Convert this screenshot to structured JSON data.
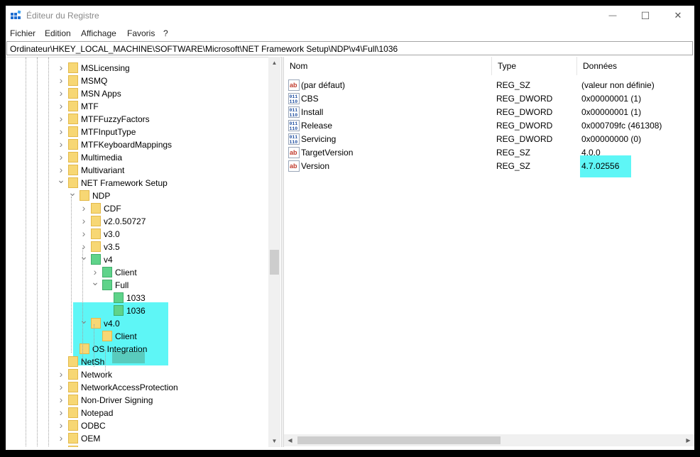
{
  "window": {
    "title": "Éditeur du Registre",
    "controls": {
      "minimize": "—",
      "maximize": "☐",
      "close": "✕"
    }
  },
  "menu": [
    "Fichier",
    "Edition",
    "Affichage",
    "Favoris",
    "?"
  ],
  "address": "Ordinateur\\HKEY_LOCAL_MACHINE\\SOFTWARE\\Microsoft\\NET Framework Setup\\NDP\\v4\\Full\\1036",
  "tree": {
    "items": [
      {
        "label": "MSLicensing",
        "expander": "collapsed"
      },
      {
        "label": "MSMQ",
        "expander": "collapsed"
      },
      {
        "label": "MSN Apps",
        "expander": "collapsed"
      },
      {
        "label": "MTF",
        "expander": "collapsed"
      },
      {
        "label": "MTFFuzzyFactors",
        "expander": "collapsed"
      },
      {
        "label": "MTFInputType",
        "expander": "collapsed"
      },
      {
        "label": "MTFKeyboardMappings",
        "expander": "collapsed"
      },
      {
        "label": "Multimedia",
        "expander": "collapsed"
      },
      {
        "label": "Multivariant",
        "expander": "collapsed"
      },
      {
        "label": "NET Framework Setup",
        "expander": "expanded"
      },
      {
        "label": "NDP",
        "expander": "expanded"
      },
      {
        "label": "CDF",
        "expander": "collapsed"
      },
      {
        "label": "v2.0.50727",
        "expander": "collapsed"
      },
      {
        "label": "v3.0",
        "expander": "collapsed"
      },
      {
        "label": "v3.5",
        "expander": "collapsed"
      },
      {
        "label": "v4",
        "expander": "expanded"
      },
      {
        "label": "Client",
        "expander": "collapsed"
      },
      {
        "label": "Full",
        "expander": "expanded"
      },
      {
        "label": "1033",
        "expander": "none"
      },
      {
        "label": "1036",
        "expander": "none",
        "selected": true
      },
      {
        "label": "v4.0",
        "expander": "expanded"
      },
      {
        "label": "Client",
        "expander": "none"
      },
      {
        "label": "OS Integration",
        "expander": "none"
      },
      {
        "label": "NetSh",
        "expander": "none"
      },
      {
        "label": "Network",
        "expander": "collapsed"
      },
      {
        "label": "NetworkAccessProtection",
        "expander": "collapsed"
      },
      {
        "label": "Non-Driver Signing",
        "expander": "collapsed"
      },
      {
        "label": "Notepad",
        "expander": "collapsed"
      },
      {
        "label": "ODBC",
        "expander": "collapsed"
      },
      {
        "label": "OEM",
        "expander": "collapsed"
      },
      {
        "label": "Office",
        "expander": "collapsed"
      }
    ]
  },
  "values": {
    "columns": [
      "Nom",
      "Type",
      "Données"
    ],
    "rows": [
      {
        "icon": "string-value-icon",
        "name": "(par défaut)",
        "type": "REG_SZ",
        "data": "(valeur non définie)"
      },
      {
        "icon": "dword-value-icon",
        "name": "CBS",
        "type": "REG_DWORD",
        "data": "0x00000001 (1)"
      },
      {
        "icon": "dword-value-icon",
        "name": "Install",
        "type": "REG_DWORD",
        "data": "0x00000001 (1)"
      },
      {
        "icon": "dword-value-icon",
        "name": "Release",
        "type": "REG_DWORD",
        "data": "0x000709fc (461308)"
      },
      {
        "icon": "dword-value-icon",
        "name": "Servicing",
        "type": "REG_DWORD",
        "data": "0x00000000 (0)"
      },
      {
        "icon": "string-value-icon",
        "name": "TargetVersion",
        "type": "REG_SZ",
        "data": "4.0.0"
      },
      {
        "icon": "string-value-icon",
        "name": "Version",
        "type": "REG_SZ",
        "data": "4.7.02556"
      }
    ]
  },
  "colors": {
    "highlight": "#5ef6f6",
    "folder": "#f7d774",
    "folder_highlighted": "#5fd38a",
    "selection": "#59cbbd"
  }
}
